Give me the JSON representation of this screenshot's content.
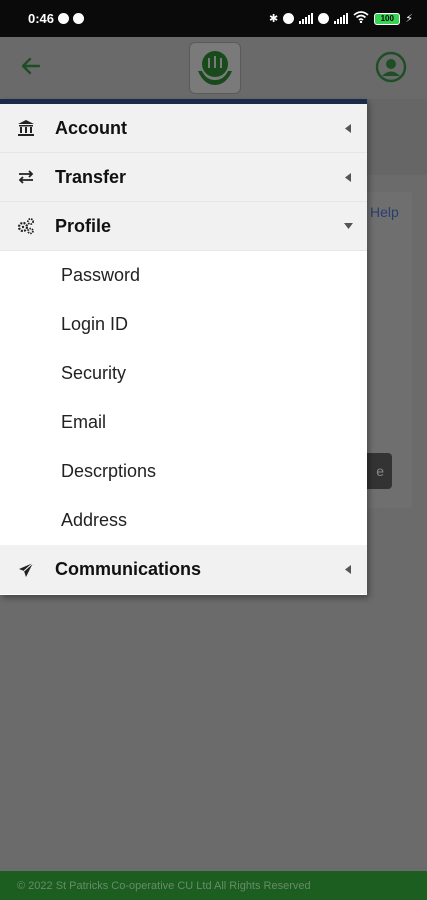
{
  "status_bar": {
    "time": "0:46",
    "battery": "100"
  },
  "menu": {
    "items": [
      {
        "label": "Account",
        "icon": "bank-icon",
        "expanded": false
      },
      {
        "label": "Transfer",
        "icon": "transfer-icon",
        "expanded": false
      },
      {
        "label": "Profile",
        "icon": "gears-icon",
        "expanded": true,
        "children": [
          "Password",
          "Login ID",
          "Security",
          "Email",
          "Descrptions",
          "Address"
        ]
      },
      {
        "label": "Communications",
        "icon": "paper-plane-icon",
        "expanded": false
      }
    ]
  },
  "background": {
    "help_link": "Help",
    "button_fragment": "e"
  },
  "footer": {
    "text": "© 2022 St Patricks Co-operative CU Ltd All Rights Reserved"
  },
  "colors": {
    "brand_green": "#1b5e20",
    "menu_border": "#1b2a4a"
  }
}
